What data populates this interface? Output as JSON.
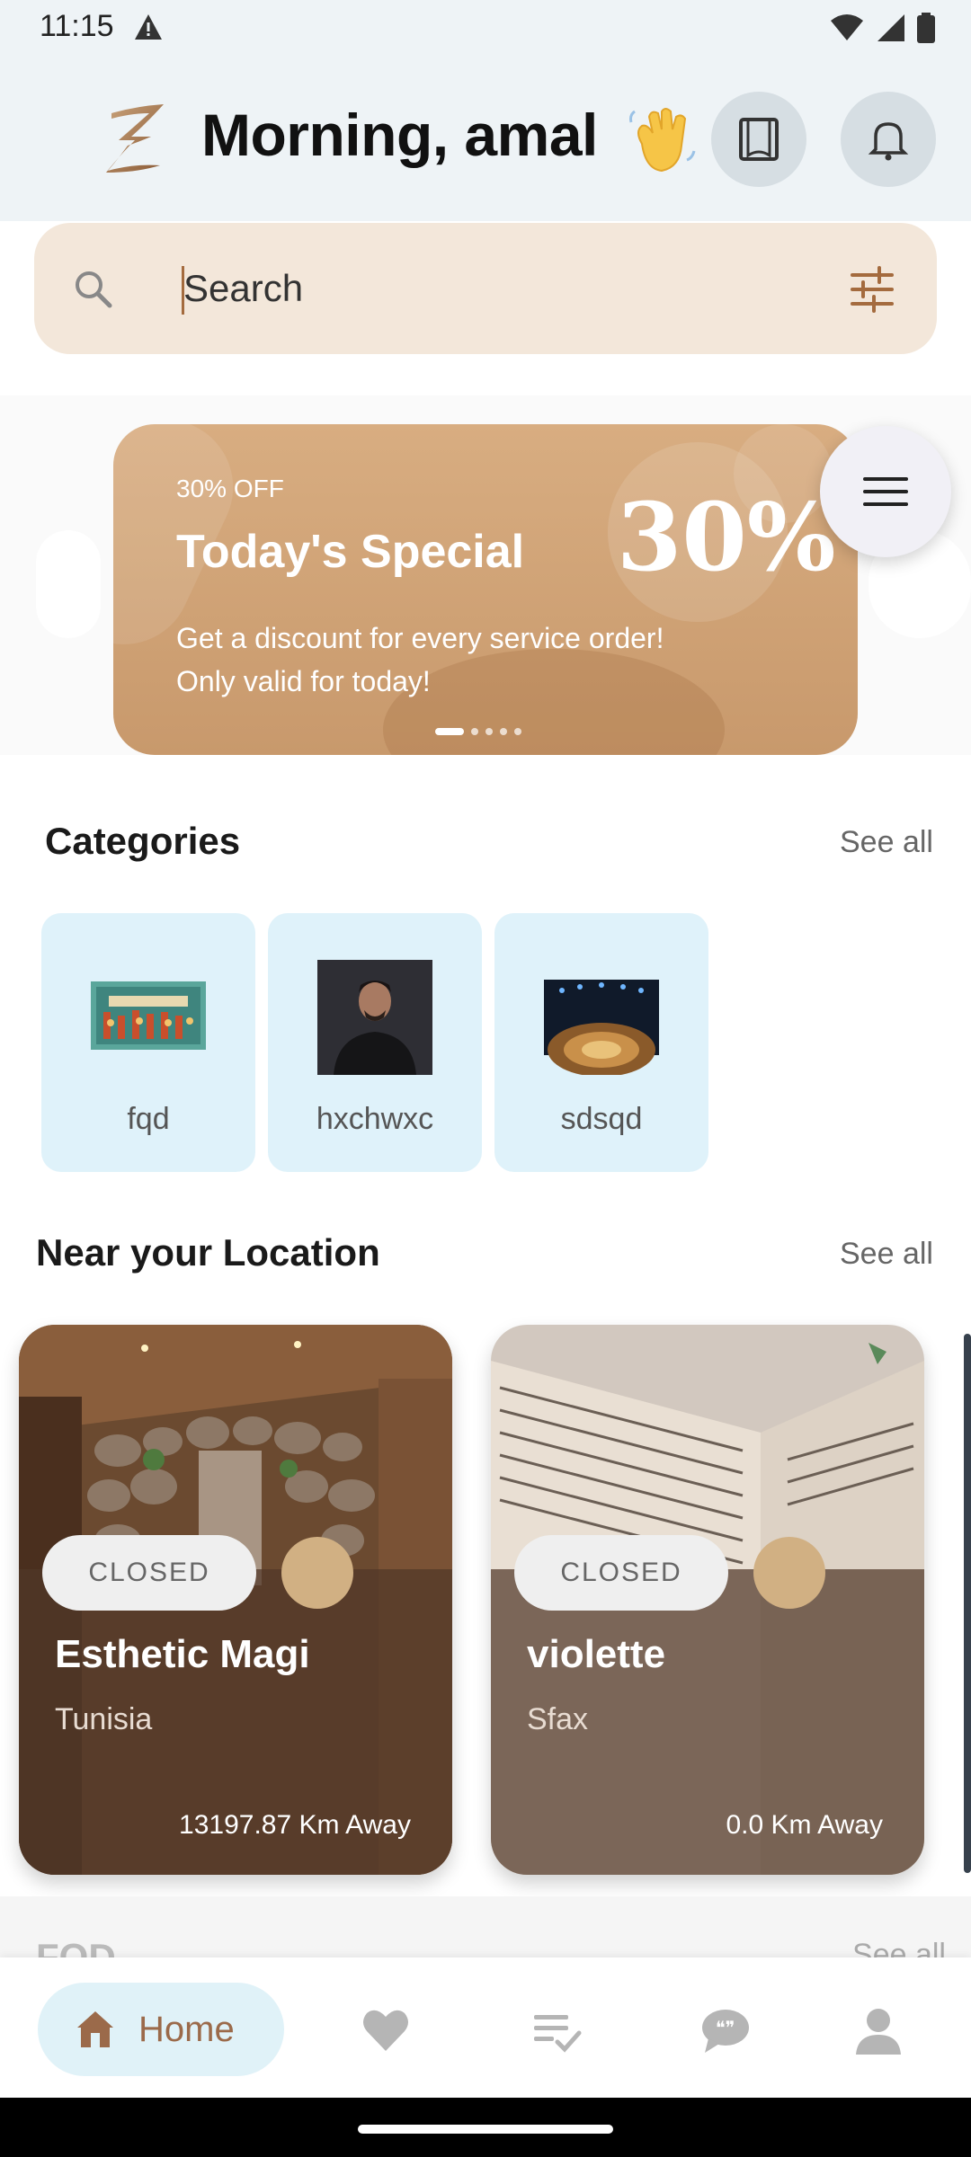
{
  "status_bar": {
    "time": "11:15"
  },
  "header": {
    "greeting": "Morning, amal"
  },
  "search": {
    "placeholder": "Search"
  },
  "banner": {
    "discount_label": "30% OFF",
    "title": "Today's Special",
    "percentage": "30%",
    "description_line1": "Get a discount for every service order!",
    "description_line2": "Only valid for today!",
    "active_slide": 1,
    "slide_count": 5
  },
  "categories": {
    "title": "Categories",
    "see_all": "See all",
    "items": [
      {
        "label": "fqd",
        "icon": "casa-craft-image"
      },
      {
        "label": "hxchwxc",
        "icon": "portrait-image"
      },
      {
        "label": "sdsqd",
        "icon": "auditorium-image"
      }
    ]
  },
  "near": {
    "title": "Near your Location",
    "see_all": "See all",
    "items": [
      {
        "status": "CLOSED",
        "name": "Esthetic Magi",
        "city": "Tunisia",
        "distance": "13197.87 Km Away",
        "image": "spa-waterfall-photo"
      },
      {
        "status": "CLOSED",
        "name": "violette",
        "city": "Sfax",
        "distance": "0.0 Km Away",
        "image": "open-book-photo"
      }
    ]
  },
  "next_section": {
    "title": "FQD",
    "see_all": "See all"
  },
  "bottom_nav": {
    "home_label": "Home",
    "items": [
      "home-icon",
      "heart-icon",
      "list-check-icon",
      "chat-icon",
      "profile-icon"
    ]
  },
  "colors": {
    "accent": "#a46b3e",
    "banner": "#d4a679",
    "category_bg": "#dff2fa",
    "search_bg": "#f3e7da",
    "nav_active_bg": "#e0f2f8"
  }
}
